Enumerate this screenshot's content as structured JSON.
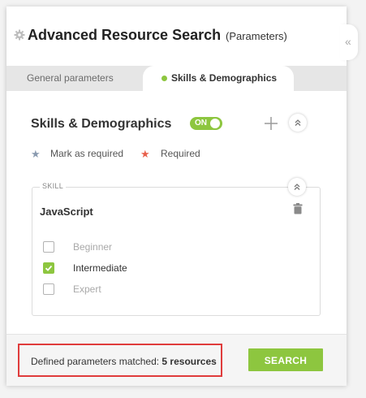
{
  "header": {
    "title": "Advanced Resource Search",
    "subtitle": "(Parameters)",
    "gear_icon": "gear-icon",
    "collapse_icon": "double-chevron-left-icon",
    "collapse_symbol": "«"
  },
  "tabs": [
    {
      "label": "General parameters",
      "active": false
    },
    {
      "label": "Skills & Demographics",
      "active": true
    }
  ],
  "section": {
    "title": "Skills & Demographics",
    "toggle_label": "ON",
    "toggle_on": true,
    "add_icon": "plus-icon",
    "collapse_icon": "chevron-up-icon"
  },
  "legend": {
    "mark_as_required": "Mark as required",
    "required": "Required",
    "mark_star_color": "#8a9bb0",
    "required_star_color": "#e8604c",
    "star_symbol": "★"
  },
  "skill": {
    "section_label": "SKILL",
    "name": "JavaScript",
    "delete_icon": "trash-icon",
    "levels": [
      {
        "label": "Beginner",
        "checked": false
      },
      {
        "label": "Intermediate",
        "checked": true
      },
      {
        "label": "Expert",
        "checked": false
      }
    ]
  },
  "footer": {
    "status_prefix": "Defined parameters matched: ",
    "status_count": "5 resources",
    "search_label": "SEARCH"
  },
  "colors": {
    "accent": "#8dc63f",
    "highlight_border": "#e03c3c"
  }
}
